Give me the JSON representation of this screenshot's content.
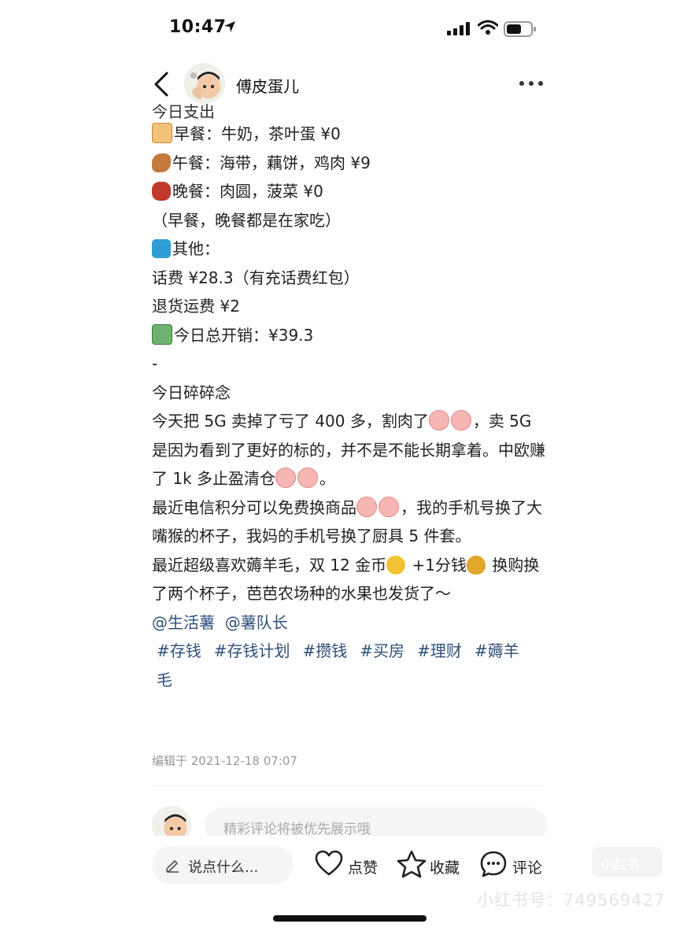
{
  "status_bar": {
    "time": "10:47"
  },
  "header": {
    "author": "傅皮蛋儿"
  },
  "post": {
    "cut_line": "今日支出",
    "lines": [
      {
        "icon": "bread-emoji",
        "text": "早餐：牛奶，茶叶蛋 ¥0"
      },
      {
        "icon": "drumstick-emoji",
        "text": "午餐：海带，藕饼，鸡肉 ¥9"
      },
      {
        "icon": "meat-emoji",
        "text": "晚餐：肉圆，菠菜 ¥0"
      },
      {
        "icon": "",
        "text": "（早餐，晚餐都是在家吃）"
      },
      {
        "icon": "bus-emoji",
        "text": "其他："
      },
      {
        "icon": "",
        "text": "话费 ¥28.3（有充话费红包）"
      },
      {
        "icon": "",
        "text": "退货运费 ¥2"
      },
      {
        "icon": "money-emoji",
        "text": "今日总开销：¥39.3"
      },
      {
        "icon": "",
        "text": "-"
      },
      {
        "icon": "",
        "text": "今日碎碎念"
      }
    ],
    "para1_a": "今天把 5G 卖掉了亏了 400 多，割肉了",
    "para1_b": "，卖 5G 是因为看到了更好的标的，并不是不能长期拿着。中欧赚了 1k 多止盈清仓",
    "para1_c": "。",
    "para2_a": "最近电信积分可以免费换商品",
    "para2_b": "，我的手机号换了大嘴猴的杯子，我妈的手机号换了厨具 5 件套。",
    "para3_a": "最近超级喜欢薅羊毛，双 12 金币",
    "para3_b": " +1分钱",
    "para3_c": " 换购换了两个杯子，芭芭农场种的水果也发货了～",
    "mentions": [
      "@生活薯",
      "@薯队长"
    ],
    "tags": [
      "#存钱",
      "#存钱计划",
      "#攒钱",
      "#买房",
      "#理财",
      "#薅羊毛"
    ],
    "edit_time": "编辑于 2021-12-18 07:07"
  },
  "comment": {
    "placeholder": "精彩评论将被优先展示哦"
  },
  "bottom_bar": {
    "say_placeholder": "说点什么...",
    "like_label": "点赞",
    "fav_label": "收藏",
    "comment_label": "评论"
  },
  "watermark": {
    "logo_text": "小红书",
    "id_text": "小红书号：749569427"
  },
  "colors": {
    "tag": "#2f4f79",
    "text": "#222222",
    "muted": "#999999"
  }
}
